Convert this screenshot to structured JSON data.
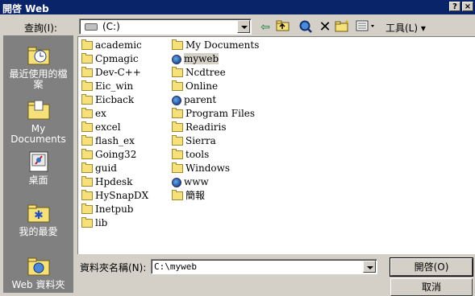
{
  "window": {
    "title": "開啓 Web",
    "help_label": "?",
    "close_label": "×"
  },
  "toolbar": {
    "look_in_label": "查詢(I):",
    "look_in_value": "(C:)",
    "tools_label": "工具(L) ▾"
  },
  "places": [
    {
      "label": "最近使用的檔案",
      "icon": "recent-folder-icon"
    },
    {
      "label": "My Documents",
      "icon": "my-documents-icon"
    },
    {
      "label": "桌面",
      "icon": "desktop-icon"
    },
    {
      "label": "我的最愛",
      "icon": "favorites-icon"
    },
    {
      "label": "Web 資料夾",
      "icon": "web-folders-icon"
    }
  ],
  "files": {
    "col1": [
      {
        "name": "academic",
        "type": "folder"
      },
      {
        "name": "Cpmagic",
        "type": "folder"
      },
      {
        "name": "Dev-C++",
        "type": "folder"
      },
      {
        "name": "Eic_win",
        "type": "folder"
      },
      {
        "name": "Eicback",
        "type": "folder"
      },
      {
        "name": "ex",
        "type": "folder"
      },
      {
        "name": "excel",
        "type": "folder"
      },
      {
        "name": "flash_ex",
        "type": "folder"
      },
      {
        "name": "Going32",
        "type": "folder"
      },
      {
        "name": "guid",
        "type": "folder"
      },
      {
        "name": "Hpdesk",
        "type": "folder"
      },
      {
        "name": "HySnapDX",
        "type": "folder"
      },
      {
        "name": "Inetpub",
        "type": "folder"
      },
      {
        "name": "lib",
        "type": "folder"
      }
    ],
    "col2": [
      {
        "name": "My Documents",
        "type": "folder"
      },
      {
        "name": "myweb",
        "type": "weblink",
        "selected": true
      },
      {
        "name": "Ncdtree",
        "type": "folder"
      },
      {
        "name": "Online",
        "type": "folder"
      },
      {
        "name": "parent",
        "type": "weblink"
      },
      {
        "name": "Program Files",
        "type": "folder"
      },
      {
        "name": "Readiris",
        "type": "folder"
      },
      {
        "name": "Sierra",
        "type": "folder"
      },
      {
        "name": "tools",
        "type": "folder"
      },
      {
        "name": "Windows",
        "type": "folder"
      },
      {
        "name": "www",
        "type": "weblink"
      },
      {
        "name": "簡報",
        "type": "folder"
      }
    ]
  },
  "bottom": {
    "filename_label": "資料夾名稱(N):",
    "filename_value": "C:\\myweb",
    "open_label": "開啓(O)",
    "cancel_label": "取消"
  },
  "colors": {
    "titlebar": "#0a246a",
    "face": "#d4d0c8",
    "places_bg": "#808080",
    "folder": "#f6e07a"
  }
}
